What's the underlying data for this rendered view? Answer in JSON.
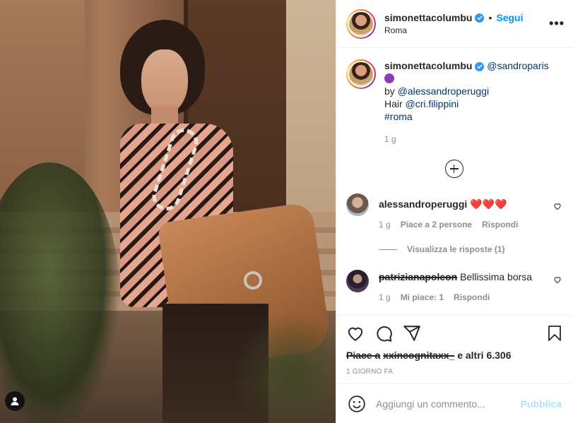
{
  "post": {
    "username": "simonettacolumbu",
    "follow_label": "Segui",
    "location": "Roma",
    "dot": "•",
    "more": "•••"
  },
  "caption": {
    "username": "simonettacolumbu",
    "mention": "@sandroparis",
    "by_label": "by",
    "by_mention": "@alessandroperuggi",
    "hair_label": "Hair",
    "hair_mention": "@cri.filippini",
    "hashtag": "#roma",
    "time": "1 g"
  },
  "comments": [
    {
      "username": "alessandroperuggi",
      "text": "❤️❤️❤️",
      "time": "1 g",
      "likes": "Piace a 2 persone",
      "reply": "Rispondi",
      "view_replies": "Visualizza le risposte (1)"
    },
    {
      "username": "patrizianapoleon",
      "text": "Bellissima borsa",
      "time": "1 g",
      "likes": "Mi piace: 1",
      "reply": "Rispondi"
    }
  ],
  "actions": {
    "likes_prefix": "Piace a",
    "likes_user": "xxincognitaxx_",
    "likes_suffix": "e altri 6.306",
    "timestamp": "1 GIORNO FA"
  },
  "add_comment": {
    "placeholder": "Aggiungi un commento...",
    "publish": "Pubblica"
  },
  "colors": {
    "accent": "#0095f6",
    "publish_disabled": "#b2dffc",
    "link": "#00376b",
    "muted": "#8e8e8e",
    "heart": "#e0245e"
  }
}
